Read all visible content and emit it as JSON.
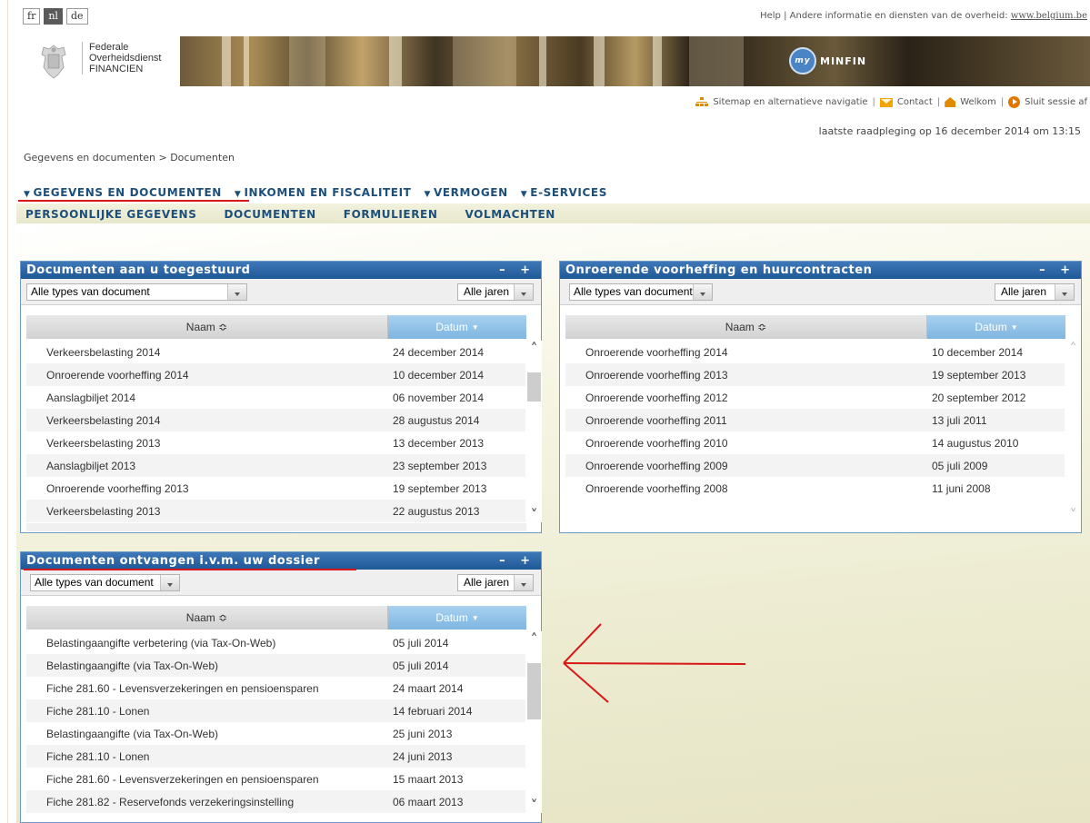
{
  "langs": [
    "fr",
    "nl",
    "de"
  ],
  "topbar": {
    "help": "Help",
    "sep": "|",
    "other_info": "Andere informatie en diensten van de overheid:",
    "belgium_link": "www.belgium.be"
  },
  "logo": {
    "line1": "Federale",
    "line2": "Overheidsdienst",
    "line3": "FINANCIEN"
  },
  "banner": {
    "brand_small": "my",
    "brand": "MINFIN"
  },
  "util": {
    "sitemap": "Sitemap en alternatieve navigatie",
    "contact": "Contact",
    "welcome": "Welkom",
    "logout": "Sluit sessie af"
  },
  "last_visit": "laatste raadpleging op 16 december 2014 om 13:15",
  "breadcrumb": "Gegevens en documenten > Documenten",
  "nav_main": [
    "GEGEVENS EN DOCUMENTEN",
    "INKOMEN EN FISCALITEIT",
    "VERMOGEN",
    "E-SERVICES"
  ],
  "nav_sub": [
    "PERSOONLIJKE GEGEVENS",
    "DOCUMENTEN",
    "FORMULIEREN",
    "VOLMACHTEN"
  ],
  "panel1": {
    "title": "Documenten aan u toegestuurd",
    "controls": "– +",
    "type_filter": "Alle types van document",
    "year_filter": "Alle jaren",
    "col_naam": "Naam ≎",
    "col_datum": "Datum",
    "rows": [
      {
        "naam": "Verkeersbelasting 2014",
        "datum": "24 december 2014"
      },
      {
        "naam": "Onroerende voorheffing 2014",
        "datum": "10 december 2014"
      },
      {
        "naam": "Aanslagbiljet 2014",
        "datum": "06 november 2014"
      },
      {
        "naam": "Verkeersbelasting 2014",
        "datum": "28 augustus 2014"
      },
      {
        "naam": "Verkeersbelasting 2013",
        "datum": "13 december 2013"
      },
      {
        "naam": "Aanslagbiljet 2013",
        "datum": "23 september 2013"
      },
      {
        "naam": "Onroerende voorheffing 2013",
        "datum": "19 september 2013"
      },
      {
        "naam": "Verkeersbelasting 2013",
        "datum": "22 augustus 2013"
      }
    ]
  },
  "panel2": {
    "title": "Onroerende voorheffing en huurcontracten",
    "controls": "– +",
    "type_filter": "Alle types van document",
    "year_filter": "Alle jaren",
    "col_naam": "Naam ≎",
    "col_datum": "Datum",
    "rows": [
      {
        "naam": "Onroerende voorheffing 2014",
        "datum": "10 december 2014"
      },
      {
        "naam": "Onroerende voorheffing 2013",
        "datum": "19 september 2013"
      },
      {
        "naam": "Onroerende voorheffing 2012",
        "datum": "20 september 2012"
      },
      {
        "naam": "Onroerende voorheffing 2011",
        "datum": "13 juli 2011"
      },
      {
        "naam": "Onroerende voorheffing 2010",
        "datum": "14 augustus 2010"
      },
      {
        "naam": "Onroerende voorheffing 2009",
        "datum": "05 juli 2009"
      },
      {
        "naam": "Onroerende voorheffing 2008",
        "datum": "11 juni 2008"
      }
    ]
  },
  "panel3": {
    "title": "Documenten ontvangen i.v.m. uw dossier",
    "controls": "– +",
    "type_filter": "Alle types van document",
    "year_filter": "Alle jaren",
    "col_naam": "Naam ≎",
    "col_datum": "Datum",
    "rows": [
      {
        "naam": "Belastingaangifte verbetering (via Tax-On-Web)",
        "datum": "05 juli 2014"
      },
      {
        "naam": "Belastingaangifte (via Tax-On-Web)",
        "datum": "05 juli 2014"
      },
      {
        "naam": "Fiche 281.60 - Levensverzekeringen en pensioensparen",
        "datum": "24 maart 2014"
      },
      {
        "naam": "Fiche 281.10 - Lonen",
        "datum": "14 februari 2014"
      },
      {
        "naam": "Belastingaangifte (via Tax-On-Web)",
        "datum": "25 juni 2013"
      },
      {
        "naam": "Fiche 281.10 - Lonen",
        "datum": "24 juni 2013"
      },
      {
        "naam": "Fiche 281.60 - Levensverzekeringen en pensioensparen",
        "datum": "15 maart 2013"
      },
      {
        "naam": "Fiche 281.82 - Reservefonds verzekeringsinstelling",
        "datum": "06 maart 2013"
      }
    ]
  },
  "colors": {
    "brand_blue": "#1c4f7c",
    "annotation_red": "#d81818",
    "header_blue": "#2a66a8"
  }
}
